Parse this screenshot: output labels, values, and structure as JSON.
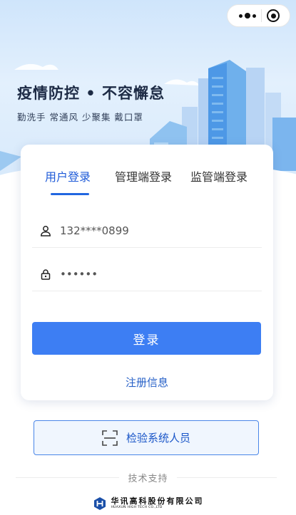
{
  "header": {
    "slogan": "疫情防控 • 不容懈怠",
    "tips": "勤洗手  常通风  少聚集  戴口罩"
  },
  "tabs": [
    {
      "label": "用户登录",
      "active": true
    },
    {
      "label": "管理端登录",
      "active": false
    },
    {
      "label": "监管端登录",
      "active": false
    }
  ],
  "form": {
    "phone_value": "132****0899",
    "password_value": "••••••"
  },
  "buttons": {
    "login": "登录",
    "register": "注册信息",
    "verify": "检验系统人员"
  },
  "footer": {
    "support": "技术支持",
    "company_cn": "华讯高科股份有限公司",
    "company_en": "HUAXUN HIGH TECH CO.,LTD"
  },
  "colors": {
    "accent": "#3d7ef3",
    "tab_active": "#1f5bd8",
    "link": "#2660c7"
  },
  "icons": [
    "more-dots-icon",
    "target-icon",
    "user-icon",
    "lock-icon",
    "scan-icon",
    "company-logo-icon"
  ]
}
